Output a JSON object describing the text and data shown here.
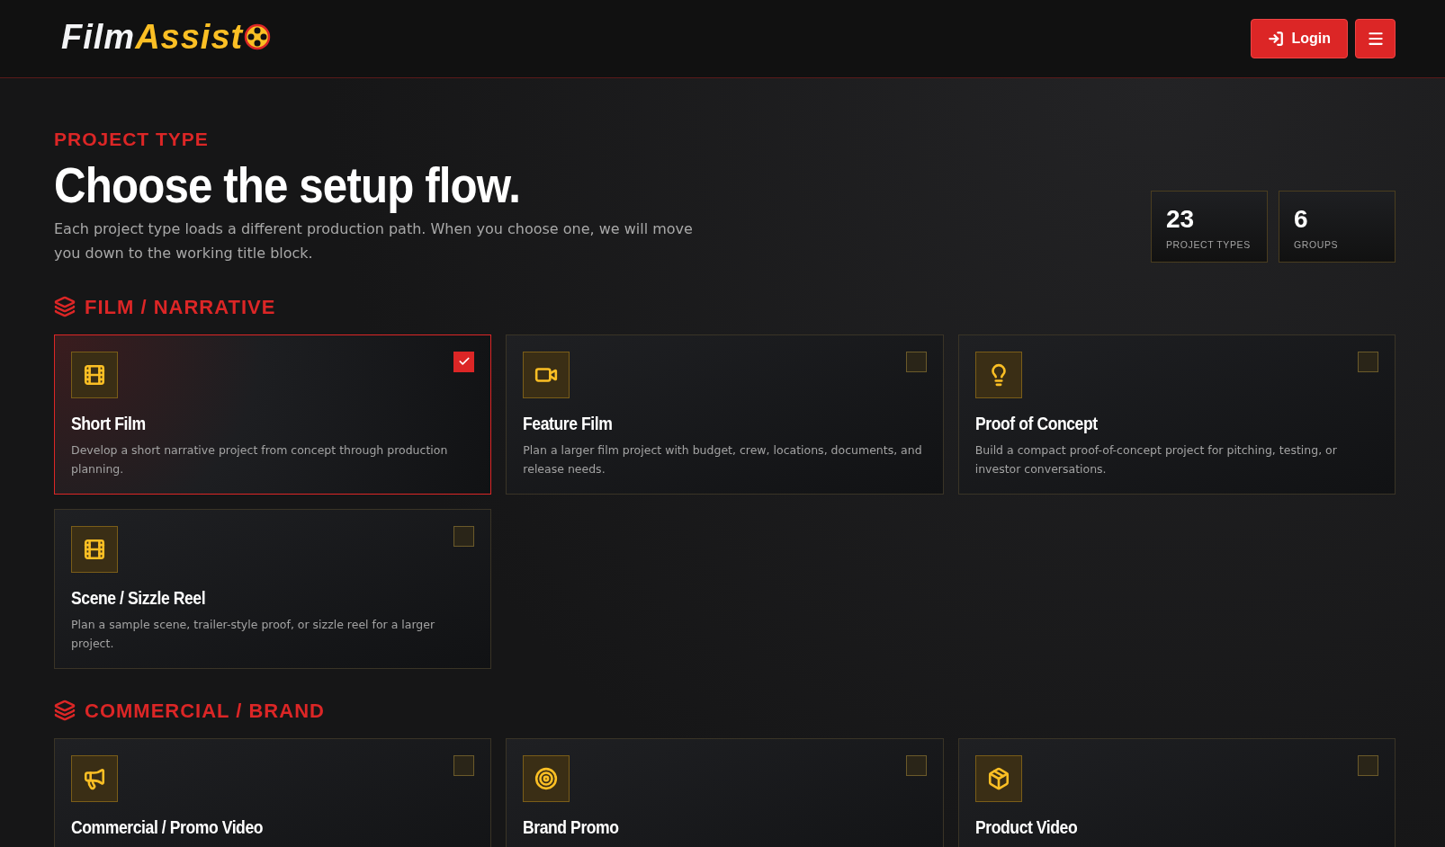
{
  "header": {
    "logo": {
      "part_1": "Film",
      "part_2": "Assist"
    },
    "login_button": "Login"
  },
  "intro": {
    "eyebrow": "PROJECT TYPE",
    "title": "Choose the setup flow.",
    "description": "Each project type loads a different production path. When you choose one, we will move you down to the working title block."
  },
  "stats": [
    {
      "value": "23",
      "label": "PROJECT TYPES"
    },
    {
      "value": "6",
      "label": "GROUPS"
    }
  ],
  "groups": [
    {
      "title": "FILM / NARRATIVE",
      "cards": [
        {
          "kind": "film",
          "title": "Short Film",
          "description": "Develop a short narrative project from concept through production planning.",
          "selected": true
        },
        {
          "kind": "video",
          "title": "Feature Film",
          "description": "Plan a larger film project with budget, crew, locations, documents, and release needs.",
          "selected": false
        },
        {
          "kind": "bulb",
          "title": "Proof of Concept",
          "description": "Build a compact proof-of-concept project for pitching, testing, or investor conversations.",
          "selected": false
        },
        {
          "kind": "film",
          "title": "Scene / Sizzle Reel",
          "description": "Plan a sample scene, trailer-style proof, or sizzle reel for a larger project.",
          "selected": false
        }
      ]
    },
    {
      "title": "COMMERCIAL / BRAND",
      "cards": [
        {
          "kind": "megaphone",
          "title": "Commercial / Promo Video",
          "selected": false
        },
        {
          "kind": "target",
          "title": "Brand Promo",
          "selected": false
        },
        {
          "kind": "box",
          "title": "Product Video",
          "selected": false
        }
      ]
    }
  ]
}
